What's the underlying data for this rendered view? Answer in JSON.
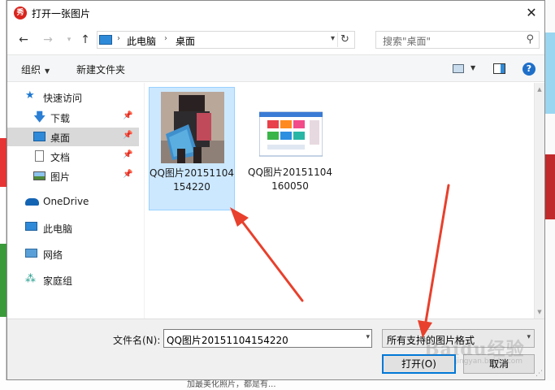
{
  "window": {
    "title": "打开一张图片",
    "app_icon_glyph": "秀"
  },
  "nav": {
    "back_icon": "arrow-left-icon",
    "forward_icon": "arrow-right-icon",
    "up_icon": "arrow-up-icon",
    "breadcrumb": [
      "此电脑",
      "桌面"
    ],
    "search_placeholder": "搜索\"桌面\""
  },
  "toolbar": {
    "organize": "组织",
    "new_folder": "新建文件夹"
  },
  "sidebar": {
    "items": [
      {
        "label": "快速访问",
        "icon": "star-icon",
        "pinned": false
      },
      {
        "label": "下载",
        "icon": "download-icon",
        "pinned": true
      },
      {
        "label": "桌面",
        "icon": "desktop-icon",
        "pinned": true,
        "selected": true
      },
      {
        "label": "文档",
        "icon": "document-icon",
        "pinned": true
      },
      {
        "label": "图片",
        "icon": "picture-icon",
        "pinned": true
      },
      {
        "label": "OneDrive",
        "icon": "cloud-icon",
        "pinned": false
      },
      {
        "label": "此电脑",
        "icon": "computer-icon",
        "pinned": false
      },
      {
        "label": "网络",
        "icon": "network-icon",
        "pinned": false
      },
      {
        "label": "家庭组",
        "icon": "homegroup-icon",
        "pinned": false
      }
    ]
  },
  "files": [
    {
      "name": "QQ图片20151104154220",
      "selected": true
    },
    {
      "name": "QQ图片20151104160050",
      "selected": false
    }
  ],
  "bottom": {
    "filename_label": "文件名(N):",
    "filename_value": "QQ图片20151104154220",
    "filetype_value": "所有支持的图片格式",
    "open_label": "打开(O)",
    "cancel_label": "取消"
  },
  "watermark": {
    "text": "Baidu经验",
    "sub": "jingyan.baidu.com"
  },
  "background_text": "加最美化照片，都是有..."
}
